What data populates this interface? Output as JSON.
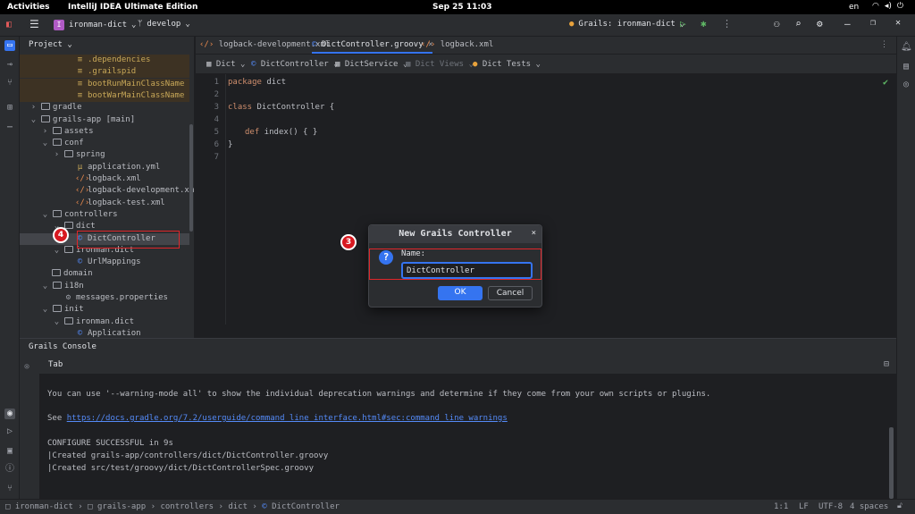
{
  "gnome": {
    "activities": "Activities",
    "app": "IntelliJ IDEA Ultimate Edition",
    "clock": "Sep 25 11:03",
    "lang": "en"
  },
  "toolbar": {
    "project": "ironman-dict",
    "project_badge": "I",
    "branch": "develop",
    "run_config": "Grails: ironman-dict"
  },
  "project_panel": {
    "title": "Project",
    "rows": [
      {
        "label": ".dependencies",
        "indent": 4,
        "kind": "file",
        "hl": true
      },
      {
        "label": ".grailspid",
        "indent": 4,
        "kind": "file",
        "hl": true
      },
      {
        "label": "bootRunMainClassName",
        "indent": 4,
        "kind": "file",
        "hl": true
      },
      {
        "label": "bootWarMainClassName",
        "indent": 4,
        "kind": "file",
        "hl": true
      },
      {
        "label": "gradle",
        "indent": 1,
        "kind": "folder",
        "arrow": ">"
      },
      {
        "label": "grails-app [main]",
        "indent": 1,
        "kind": "folder",
        "arrow": "v"
      },
      {
        "label": "assets",
        "indent": 2,
        "kind": "folder",
        "arrow": ">"
      },
      {
        "label": "conf",
        "indent": 2,
        "kind": "folder",
        "arrow": "v"
      },
      {
        "label": "spring",
        "indent": 3,
        "kind": "folder",
        "arrow": ">"
      },
      {
        "label": "application.yml",
        "indent": 4,
        "kind": "yml"
      },
      {
        "label": "logback.xml",
        "indent": 4,
        "kind": "xml"
      },
      {
        "label": "logback-development.xml",
        "indent": 4,
        "kind": "xml"
      },
      {
        "label": "logback-test.xml",
        "indent": 4,
        "kind": "xml"
      },
      {
        "label": "controllers",
        "indent": 2,
        "kind": "folder",
        "arrow": "v"
      },
      {
        "label": "dict",
        "indent": 3,
        "kind": "folder",
        "arrow": "v"
      },
      {
        "label": "DictController",
        "indent": 4,
        "kind": "class",
        "selected": true
      },
      {
        "label": "ironman.dict",
        "indent": 3,
        "kind": "folder",
        "arrow": "v"
      },
      {
        "label": "UrlMappings",
        "indent": 4,
        "kind": "class"
      },
      {
        "label": "domain",
        "indent": 2,
        "kind": "folder"
      },
      {
        "label": "i18n",
        "indent": 2,
        "kind": "folder",
        "arrow": "v"
      },
      {
        "label": "messages.properties",
        "indent": 3,
        "kind": "props"
      },
      {
        "label": "init",
        "indent": 2,
        "kind": "folder",
        "arrow": "v"
      },
      {
        "label": "ironman.dict",
        "indent": 3,
        "kind": "folder",
        "arrow": "v"
      },
      {
        "label": "Application",
        "indent": 4,
        "kind": "class"
      }
    ]
  },
  "tabs": [
    {
      "label": "logback-development.xml",
      "active": false
    },
    {
      "label": "DictController.groovy",
      "active": true
    },
    {
      "label": "logback.xml",
      "active": false
    }
  ],
  "crumbs": [
    "Dict",
    "DictController",
    "DictService",
    "Dict Views",
    "Dict Tests"
  ],
  "code": {
    "line_numbers": [
      "1",
      "2",
      "3",
      "4",
      "5",
      "6",
      "7"
    ],
    "l1_kw": "package",
    "l1": " dict",
    "l3_kw": "class",
    "l3": " DictController {",
    "l5_kw": "def",
    "l5": " index() { }",
    "l6": "}"
  },
  "console": {
    "title": "Grails Console",
    "tab": "Tab",
    "lines": {
      "warn": "You can use '--warning-mode all' to show the individual deprecation warnings and determine if they come from your own scripts or plugins.",
      "see": "See ",
      "url": "https://docs.gradle.org/7.2/userguide/command_line_interface.html#sec:command_line_warnings",
      "success": "CONFIGURE SUCCESSFUL in 9s",
      "created1": "|Created grails-app/controllers/dict/DictController.groovy",
      "created2": "|Created src/test/groovy/dict/DictControllerSpec.groovy"
    }
  },
  "dialog": {
    "title": "New Grails Controller",
    "name_label": "Name:",
    "name_value": "DictController",
    "ok": "OK",
    "cancel": "Cancel"
  },
  "annotations": {
    "marker3": "3",
    "marker4": "4"
  },
  "statusbar": {
    "path": [
      "ironman-dict",
      "grails-app",
      "controllers",
      "dict",
      "DictController"
    ],
    "position": "1:1",
    "line_sep": "LF",
    "encoding": "UTF-8",
    "indent": "4 spaces"
  },
  "colors": {
    "accent": "#3574f0",
    "annotation": "#e0262a"
  }
}
